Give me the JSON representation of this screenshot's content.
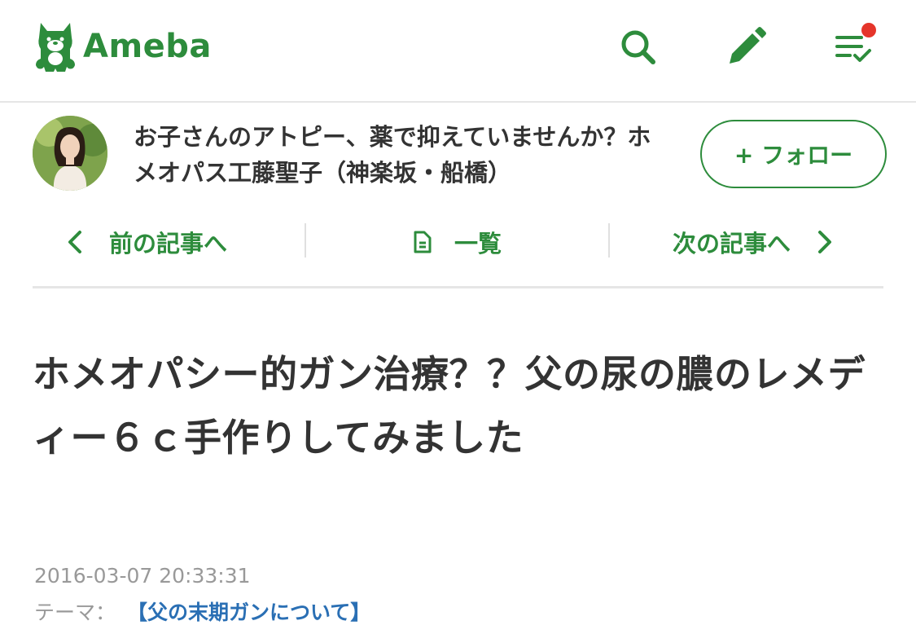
{
  "header": {
    "logo_text": "Ameba",
    "icons": {
      "search": "search-icon",
      "write": "pencil-icon",
      "menu": "checklist-icon"
    },
    "accent_color": "#2d8c3c",
    "notification_color": "#e5352a"
  },
  "blog": {
    "title": "お子さんのアトピー、薬で抑えていませんか？ホメオパス工藤聖子（神楽坂・船橋）",
    "follow_label": "+ フォロー"
  },
  "article_nav": {
    "prev_label": "前の記事へ",
    "list_label": "一覧",
    "next_label": "次の記事へ"
  },
  "article": {
    "title": "ホメオパシー的ガン治療？？父の尿の膿のレメディー６ｃ手作りしてみました",
    "date": "2016-03-07 20:33:31",
    "theme_label": "テーマ：",
    "theme_link": "【父の末期ガンについて】",
    "link_color": "#2a6fb4"
  }
}
